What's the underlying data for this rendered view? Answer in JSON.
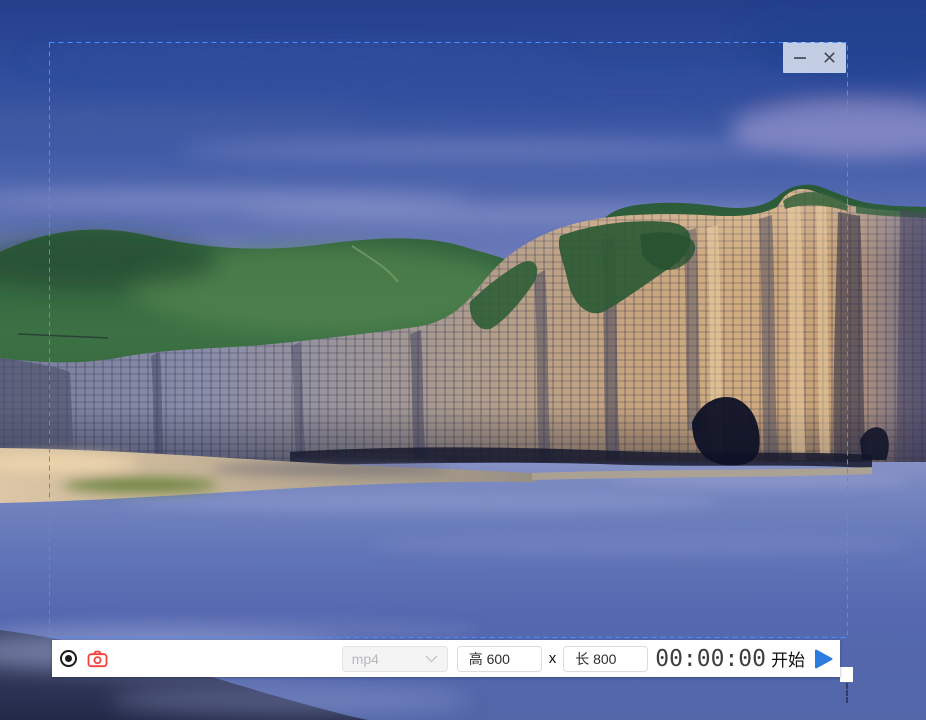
{
  "window_controls": {
    "minimize_icon": "minimize",
    "close_icon": "close"
  },
  "capture_toolbar": {
    "record_icon": "record-dot",
    "screenshot_icon": "camera",
    "format_select": {
      "value": "mp4",
      "chevron_icon": "chevron-down"
    },
    "height_field": {
      "value": "高 600"
    },
    "separator": "x",
    "width_field": {
      "value": "长 800"
    },
    "timer": "00:00:00",
    "start_label": "开始"
  },
  "colors": {
    "selection_border": "#4a8dff",
    "camera_red": "#f5413d",
    "play_blue": "#2a7ce0",
    "toolbar_bg": "#ffffff"
  }
}
